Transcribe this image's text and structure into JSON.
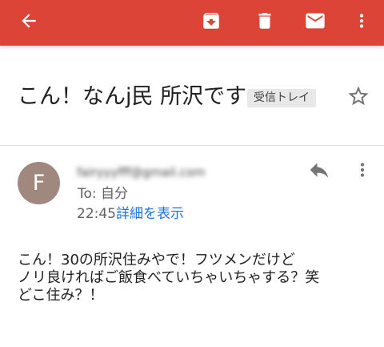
{
  "colors": {
    "toolbar": "#db4437",
    "accent_link": "#1a73e8",
    "avatar": "#a1887f"
  },
  "toolbar": {
    "back_icon": "arrow-back-icon",
    "archive_icon": "archive-icon",
    "delete_icon": "delete-icon",
    "mark_unread_icon": "mail-icon",
    "more_icon": "more-vert-icon"
  },
  "email": {
    "subject": "こん！なんj民 所沢です",
    "label": "受信トレイ",
    "star_icon": "star-outline-icon",
    "avatar_letter": "F",
    "sender": "fairyyyfff@gmail.com",
    "to": "To: 自分",
    "time": "22:45",
    "details_link": "詳細を表示",
    "reply_icon": "reply-icon",
    "more_icon": "more-vert-icon",
    "body_lines": [
      "こん！30の所沢住みやで！フツメンだけど",
      "ノリ良ければご飯食べていちゃいちゃする？笑",
      "どこ住み？！"
    ]
  }
}
